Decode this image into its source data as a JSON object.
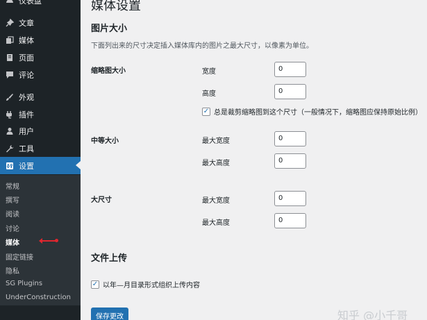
{
  "sidebar": {
    "top_item": "仪表盘",
    "items": [
      {
        "label": "文章",
        "icon": "pin-icon"
      },
      {
        "label": "媒体",
        "icon": "media-icon"
      },
      {
        "label": "页面",
        "icon": "page-icon"
      },
      {
        "label": "评论",
        "icon": "comment-icon"
      },
      {
        "label": "外观",
        "icon": "brush-icon"
      },
      {
        "label": "插件",
        "icon": "plugin-icon"
      },
      {
        "label": "用户",
        "icon": "user-icon"
      },
      {
        "label": "工具",
        "icon": "wrench-icon"
      },
      {
        "label": "设置",
        "icon": "settings-icon"
      }
    ],
    "submenu": [
      "常规",
      "撰写",
      "阅读",
      "讨论",
      "媒体",
      "固定链接",
      "隐私",
      "SG Plugins",
      "UnderConstruction"
    ]
  },
  "page": {
    "title": "媒体设置",
    "image_sizes_title": "图片大小",
    "image_sizes_desc": "下面列出来的尺寸决定插入媒体库内的图片之最大尺寸，以像素为单位。",
    "thumbnail": {
      "label": "缩略图大小",
      "width_label": "宽度",
      "width_value": "0",
      "height_label": "高度",
      "height_value": "0",
      "crop_label": "总是裁剪缩略图到这个尺寸（一般情况下，缩略图应保持原始比例）",
      "crop_checked": true
    },
    "medium": {
      "label": "中等大小",
      "max_width_label": "最大宽度",
      "max_width_value": "0",
      "max_height_label": "最大高度",
      "max_height_value": "0"
    },
    "large": {
      "label": "大尺寸",
      "max_width_label": "最大宽度",
      "max_width_value": "0",
      "max_height_label": "最大高度",
      "max_height_value": "0"
    },
    "uploads_title": "文件上传",
    "uploads_checkbox_label": "以年—月目录形式组织上传内容",
    "uploads_checked": true,
    "save_label": "保存更改"
  },
  "watermark": "知乎 @小千哥",
  "colors": {
    "sidebar_bg": "#1d2327",
    "accent": "#2271b1",
    "annotation_arrow": "#e0262e"
  }
}
